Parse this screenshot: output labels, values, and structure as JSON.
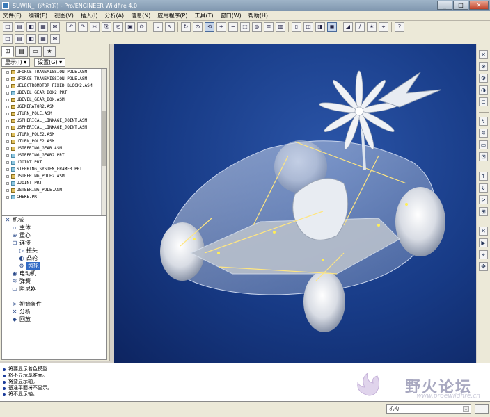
{
  "window": {
    "title": "SUWIN_I (活动的) - Pro/ENGINEER Wildfire 4.0",
    "minimize": "_",
    "maximize": "□",
    "close": "✕"
  },
  "menu": [
    "文件(F)",
    "编辑(E)",
    "视图(V)",
    "插入(I)",
    "分析(A)",
    "信息(N)",
    "应用程序(P)",
    "工具(T)",
    "窗口(W)",
    "帮助(H)"
  ],
  "toolbar1": [
    "new-icon",
    "open-icon",
    "save-icon",
    "print-icon",
    "email-icon",
    "|",
    "undo-icon",
    "redo-icon",
    "cut-icon",
    "copy-icon",
    "paste-icon",
    "paste-special-icon",
    "regenerate-icon",
    "|",
    "find-icon",
    "select-icon",
    "|",
    "repaint-icon",
    "orient-icon",
    "spin-icon",
    "zoom-in-icon",
    "zoom-out-icon",
    "refit-icon",
    "named-view-icon",
    "layers-icon",
    "view-manager-icon",
    "|",
    "wireframe-icon",
    "hidden-line-icon",
    "no-hidden-icon",
    "shading-icon",
    "|",
    "datum-plane-icon",
    "datum-axis-icon",
    "datum-point-icon",
    "csys-icon",
    "|",
    "context-help-icon"
  ],
  "toolbar2": [
    "sketch-icon",
    "plane-icon",
    "axis-icon",
    "curve-icon",
    "point-icon"
  ],
  "left_panel": {
    "tabs": [
      "model-tree-tab",
      "layer-tab",
      "folder-tab",
      "favorites-tab"
    ],
    "show_label": "显示(I) ▾",
    "settings_label": "设置(G) ▾",
    "model_tree": [
      {
        "name": "UFORCE_TRANSMISSION_POLE.ASM",
        "type": "asm"
      },
      {
        "name": "UFORCE_TRANSMISSION_POLE.ASM",
        "type": "asm"
      },
      {
        "name": "UELECTROMOTOR_FIXED_BLOCK2.ASM",
        "type": "asm"
      },
      {
        "name": "UBEVEL_GEAR_BOX2.PRT",
        "type": "prt"
      },
      {
        "name": "UBEVEL_GEAR_BOX.ASM",
        "type": "asm"
      },
      {
        "name": "UGENERATOR2.ASM",
        "type": "asm"
      },
      {
        "name": "UTURN_POLE.ASM",
        "type": "asm"
      },
      {
        "name": "USPHERICAL_LINKAGE_JOINT.ASM",
        "type": "asm"
      },
      {
        "name": "USPHERICAL_LINKAGE_JOINT.ASM",
        "type": "asm"
      },
      {
        "name": "UTURN_POLE2.ASM",
        "type": "asm"
      },
      {
        "name": "UTURN_POLE2.ASM",
        "type": "asm"
      },
      {
        "name": "USTEERING_GEAR.ASM",
        "type": "asm"
      },
      {
        "name": "USTEERING_GEAR2.PRT",
        "type": "prt"
      },
      {
        "name": "UJOINT.PRT",
        "type": "prt"
      },
      {
        "name": "STEERING_SYSTEM_FRAME3.PRT",
        "type": "prt"
      },
      {
        "name": "USTEERING_POLE2.ASM",
        "type": "asm"
      },
      {
        "name": "UJOINT.PRT",
        "type": "prt"
      },
      {
        "name": "USTEERING_POLE.ASM",
        "type": "asm"
      },
      {
        "name": "CHEKE.PRT",
        "type": "prt"
      }
    ],
    "mechanism_tree": [
      {
        "label": "机械",
        "indent": 0,
        "icon": "✕"
      },
      {
        "label": "主体",
        "indent": 1,
        "icon": "▫"
      },
      {
        "label": "重心",
        "indent": 1,
        "icon": "⊕"
      },
      {
        "label": "连接",
        "indent": 1,
        "icon": "⊟"
      },
      {
        "label": "接头",
        "indent": 2,
        "icon": "▷"
      },
      {
        "label": "凸轮",
        "indent": 2,
        "icon": "◐"
      },
      {
        "label": "齿轮",
        "indent": 2,
        "icon": "⚙",
        "selected": true
      },
      {
        "label": "电动机",
        "indent": 1,
        "icon": "◉"
      },
      {
        "label": "弹簧",
        "indent": 1,
        "icon": "≋"
      },
      {
        "label": "阻尼器",
        "indent": 1,
        "icon": "▭"
      },
      {
        "label": "",
        "indent": 1,
        "icon": ""
      },
      {
        "label": "初始条件",
        "indent": 1,
        "icon": "⊳"
      },
      {
        "label": "分析",
        "indent": 1,
        "icon": "✕"
      },
      {
        "label": "回放",
        "indent": 1,
        "icon": "◆"
      }
    ]
  },
  "viewport": {
    "background_top": "#2b55a8",
    "background_bottom": "#0d2460"
  },
  "right_toolbar": [
    "servo-motor-icon",
    "connection-icon",
    "gear-pair-icon",
    "cam-icon",
    "slot-icon",
    "|",
    "force-motor-icon",
    "spring-icon",
    "damper-icon",
    "bushing-icon",
    "|",
    "force-torque-icon",
    "gravity-icon",
    "initial-condition-icon",
    "mass-props-icon",
    "|",
    "analysis-icon",
    "playback-icon",
    "measure-icon",
    "drag-icon"
  ],
  "messages": [
    "将要显示着色模型",
    "将不显示基准面。",
    "将要显示轴。",
    "基准平面将不显示。",
    "将不显示轴。"
  ],
  "watermark": {
    "text": "野火论坛",
    "url": "www.proewildfire.cn"
  },
  "status": {
    "filter_value": "机构"
  }
}
